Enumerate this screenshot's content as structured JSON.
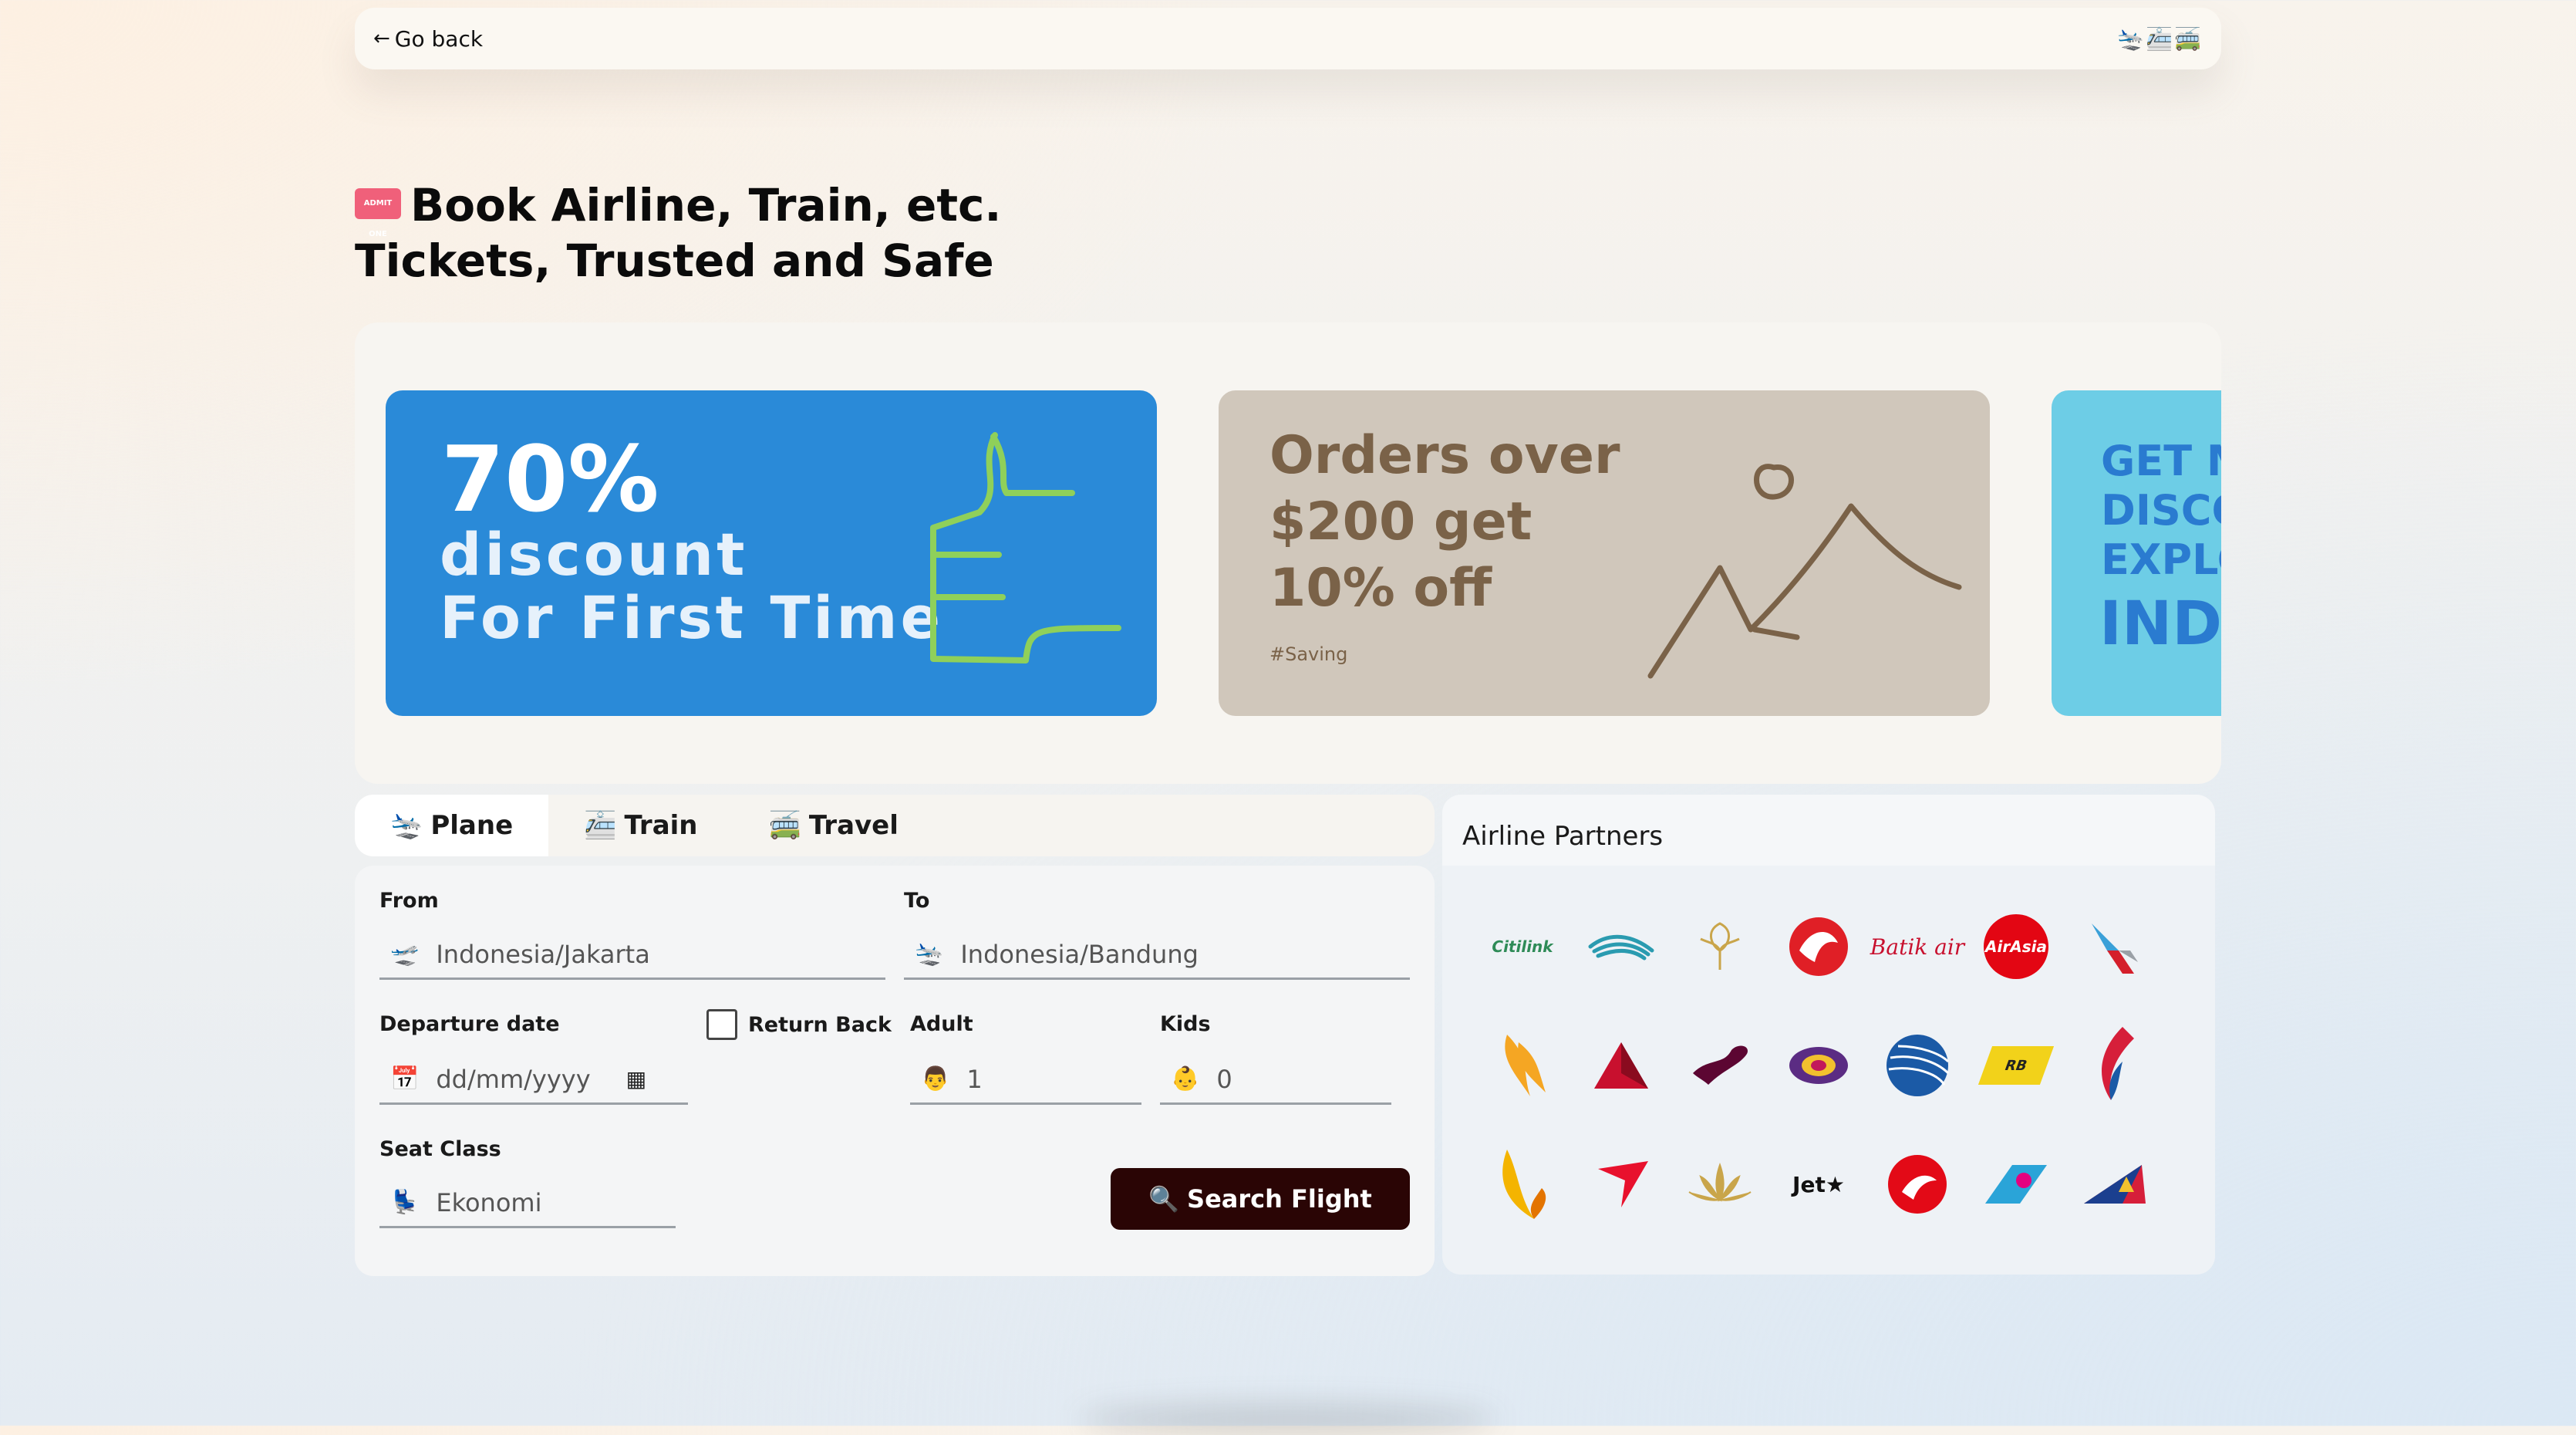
{
  "topbar": {
    "back_label": "Go back",
    "icons": "🛬🚈🚎"
  },
  "heading": {
    "line1": "Book Airline, Train, etc.",
    "line2": "Tickets, Trusted and Safe",
    "ticket_icon": "ticket-icon",
    "ticket_text": "ADMIT ONE"
  },
  "promos": {
    "p1": {
      "big": "70%",
      "line2": "discount",
      "line3": "For First Time",
      "bg": "#2a8ad8"
    },
    "p2": {
      "text": "Orders over $200 get 10% off",
      "tag": "#Saving",
      "bg": "#d0c7bb"
    },
    "p3": {
      "l1": "GET M",
      "l2": "DISCO",
      "l3": "EXPLO",
      "l4": "INDO",
      "bg": "#6dcde6"
    }
  },
  "tabs": [
    {
      "icon": "🛬",
      "label": "Plane",
      "active": true
    },
    {
      "icon": "🚈",
      "label": "Train",
      "active": false
    },
    {
      "icon": "🚎",
      "label": "Travel",
      "active": false
    }
  ],
  "form": {
    "from_label": "From",
    "from_value": "Indonesia/Jakarta",
    "to_label": "To",
    "to_value": "Indonesia/Bandung",
    "departure_label": "Departure date",
    "departure_placeholder": "dd/mm/yyyy",
    "return_label": "Return Back",
    "adult_label": "Adult",
    "adult_value": "1",
    "kids_label": "Kids",
    "kids_value": "0",
    "seat_label": "Seat Class",
    "seat_value": "Ekonomi",
    "search_label": "Search Flight",
    "search_icon": "🔍"
  },
  "partners": {
    "title": "Airline Partners",
    "logos": [
      "citilink-logo",
      "garuda-logo",
      "lion-crest-logo",
      "lion-air-logo",
      "batik-air-logo",
      "airasia-logo",
      "american-airlines-logo",
      "singapore-airlines-logo",
      "delta-logo",
      "qatar-logo",
      "thai-logo",
      "united-logo",
      "royal-brunei-logo",
      "bangkok-airways-logo",
      "wings-logo",
      "air-red-logo",
      "vietnam-lotus-logo",
      "jetstar-logo",
      "turkish-logo",
      "china-southern-logo",
      "philippine-logo"
    ],
    "citilink_text": "Citilink",
    "batik_text": "Batik air",
    "airasia_text": "AirAsia",
    "royal_brunei_text": "RB",
    "jetstar_text": "Jet★"
  },
  "colors": {
    "button_dark": "#2a0505",
    "promo_blue": "#2a8ad8",
    "promo_beige": "#d0c7bb",
    "promo_cyan": "#6dcde6"
  }
}
